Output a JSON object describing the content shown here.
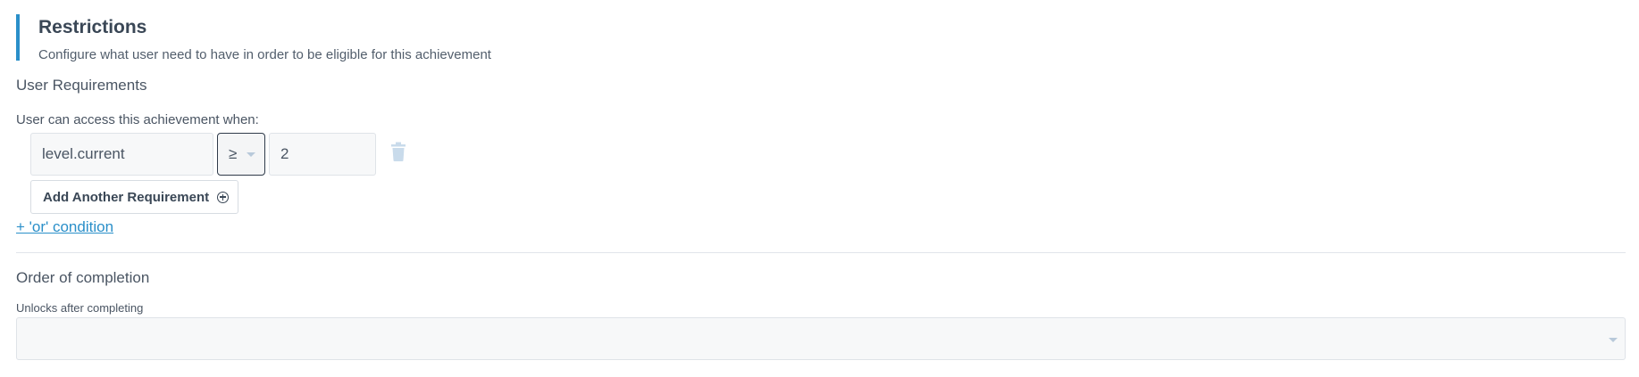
{
  "restrictions": {
    "title": "Restrictions",
    "description": "Configure what user need to have in order to be eligible for this achievement"
  },
  "user_requirements": {
    "title": "User Requirements",
    "access_label": "User can access this achievement when:",
    "requirement": {
      "key": "level.current",
      "operator": "≥",
      "value": "2"
    },
    "add_button_label": "Add Another Requirement",
    "or_condition_label": "+ 'or' condition"
  },
  "order_of_completion": {
    "title": "Order of completion",
    "unlocks_label": "Unlocks after completing",
    "unlocks_value": ""
  },
  "colors": {
    "accent": "#2a8fc9",
    "text": "#3e4a59",
    "input_bg": "#f7f8f9",
    "border": "#dfe3e8"
  },
  "icons": {
    "delete": "trash-icon",
    "add": "plus-circle-icon",
    "dropdown": "chevron-down-icon"
  }
}
